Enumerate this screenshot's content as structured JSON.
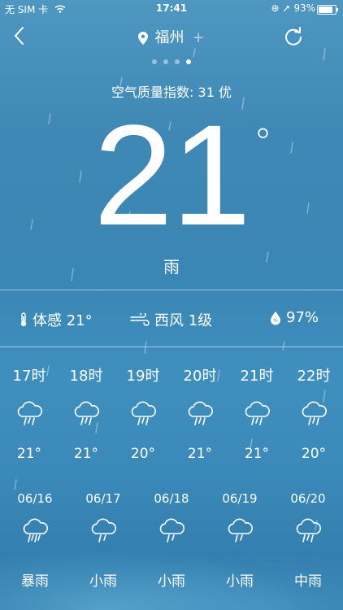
{
  "status_bar": {
    "carrier": "无 SIM 卡",
    "time": "17:41",
    "battery_text": "93%",
    "battery_level": 0.93
  },
  "location": {
    "city": "福州",
    "plus": "+"
  },
  "page_dots": {
    "count": 4,
    "active_index": 3
  },
  "aqi": "空气质量指数: 31 优",
  "current": {
    "temp": "21",
    "degree": "°",
    "condition": "雨"
  },
  "details": {
    "feels_like": "体感 21°",
    "wind": "西风 1级",
    "humidity": "97%"
  },
  "hourly": [
    {
      "time": "17时",
      "temp": "21°",
      "icon": "rain-cloud-icon"
    },
    {
      "time": "18时",
      "temp": "21°",
      "icon": "rain-cloud-icon"
    },
    {
      "time": "19时",
      "temp": "20°",
      "icon": "rain-cloud-icon"
    },
    {
      "time": "20时",
      "temp": "21°",
      "icon": "rain-cloud-icon"
    },
    {
      "time": "21时",
      "temp": "21°",
      "icon": "rain-cloud-icon"
    },
    {
      "time": "22时",
      "temp": "20°",
      "icon": "rain-cloud-icon"
    }
  ],
  "daily": [
    {
      "date": "06/16",
      "condition": "暴雨",
      "icon": "heavy-rain-cloud-icon"
    },
    {
      "date": "06/17",
      "condition": "小雨",
      "icon": "light-rain-cloud-icon"
    },
    {
      "date": "06/18",
      "condition": "小雨",
      "icon": "light-rain-cloud-icon"
    },
    {
      "date": "06/19",
      "condition": "小雨",
      "icon": "light-rain-cloud-icon"
    },
    {
      "date": "06/20",
      "condition": "中雨",
      "icon": "moderate-rain-cloud-icon"
    }
  ]
}
